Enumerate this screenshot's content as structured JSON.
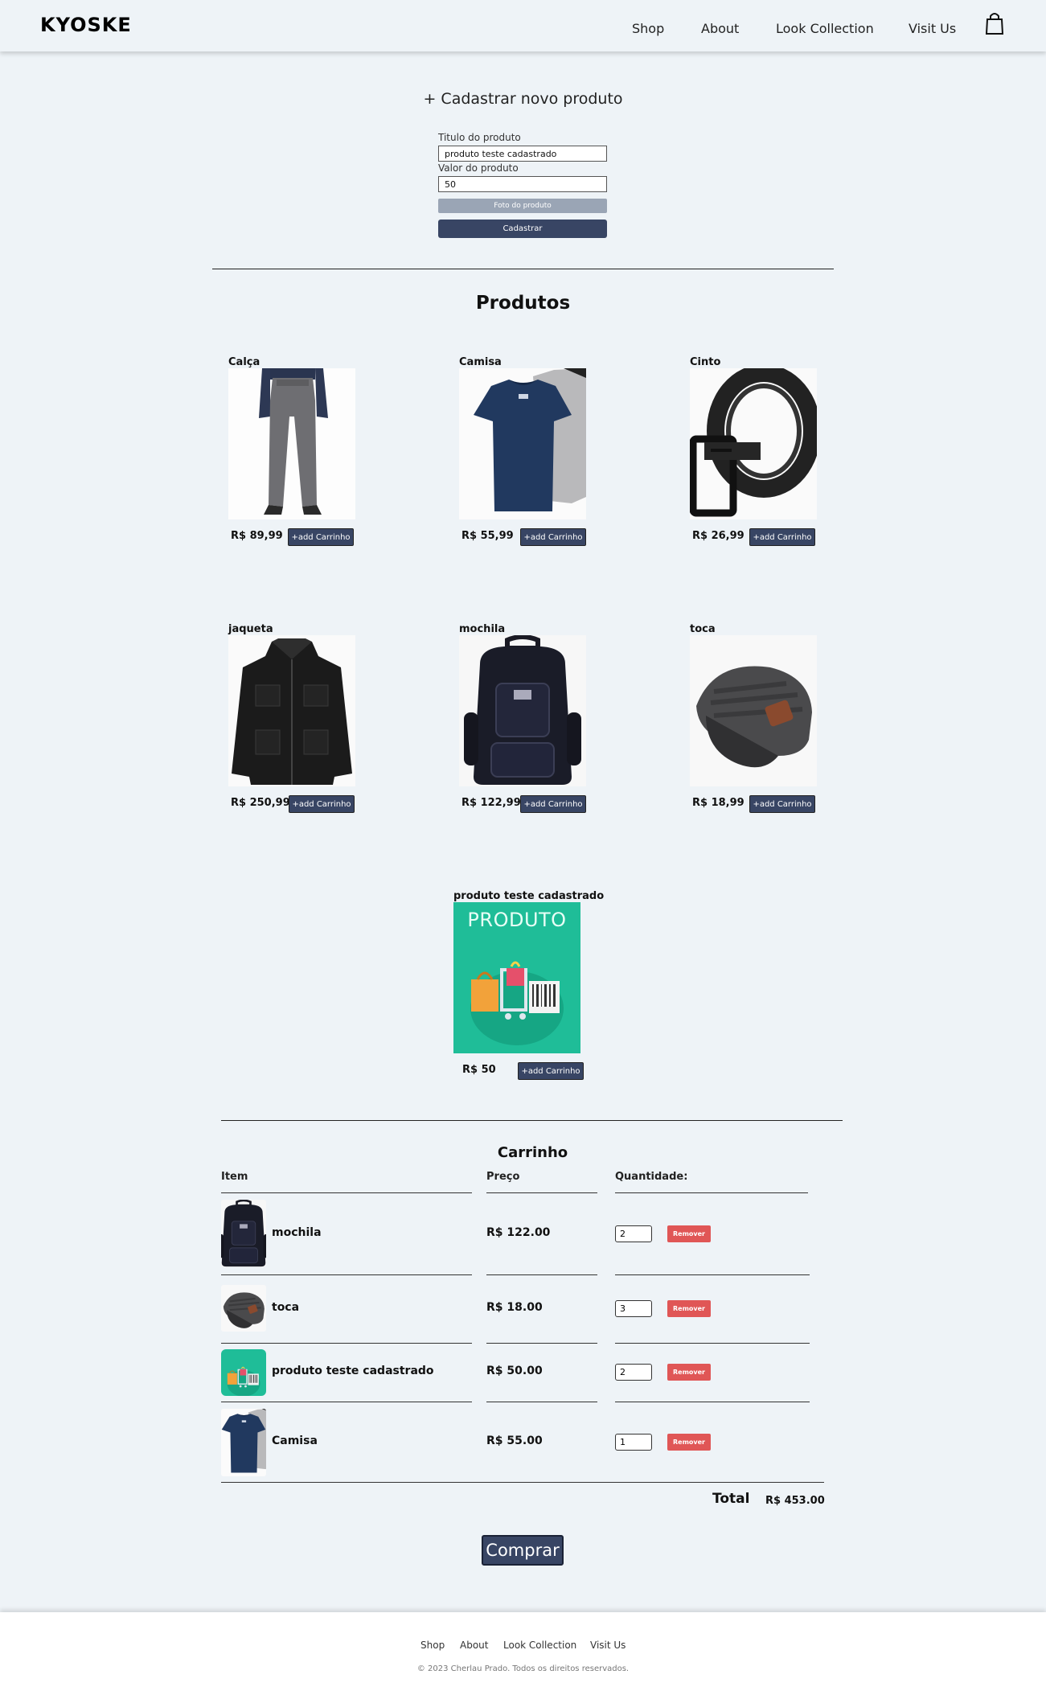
{
  "header": {
    "logo": "KYOSKE",
    "nav": [
      "Shop",
      "About",
      "Look Collection",
      "Visit Us"
    ]
  },
  "form": {
    "title": "+ Cadastrar novo produto",
    "title_label": "Titulo do produto",
    "title_value": "produto teste cadastrado",
    "value_label": "Valor do produto",
    "value_value": "50",
    "photo_button": "Foto do produto",
    "submit_button": "Cadastrar"
  },
  "products": {
    "title": "Produtos",
    "add_label": "+add Carrinho",
    "items": [
      {
        "name": "Calça",
        "price": "R$ 89,99",
        "icon": "pants-icon"
      },
      {
        "name": "Camisa",
        "price": "R$ 55,99",
        "icon": "tshirt-icon"
      },
      {
        "name": "Cinto",
        "price": "R$ 26,99",
        "icon": "belt-icon"
      },
      {
        "name": "jaqueta",
        "price": "R$ 250,99",
        "icon": "jacket-icon"
      },
      {
        "name": "mochila",
        "price": "R$ 122,99",
        "icon": "backpack-icon"
      },
      {
        "name": "toca",
        "price": "R$ 18,99",
        "icon": "beanie-icon"
      },
      {
        "name": "produto teste cadastrado",
        "price": "R$ 50",
        "icon": "produto-placeholder-icon",
        "image_text": "PRODUTO"
      }
    ]
  },
  "cart": {
    "title": "Carrinho",
    "headers": {
      "item": "Item",
      "price": "Preço",
      "qty": "Quantidade:"
    },
    "remove_label": "Remover",
    "rows": [
      {
        "name": "mochila",
        "price": "R$ 122.00",
        "qty": "2"
      },
      {
        "name": "toca",
        "price": "R$ 18.00",
        "qty": "3"
      },
      {
        "name": "produto teste cadastrado",
        "price": "R$ 50.00",
        "qty": "2"
      },
      {
        "name": "Camisa",
        "price": "R$ 55.00",
        "qty": "1"
      }
    ],
    "total_label": "Total",
    "total_value": "R$ 453.00",
    "buy_button": "Comprar"
  },
  "footer": {
    "links": [
      "Shop",
      "About",
      "Look Collection",
      "Visit Us"
    ],
    "copyright": "© 2023 Cherlau Prado. Todos os direitos reservados."
  },
  "colors": {
    "background": "#eef3f7",
    "primary_button": "#384564",
    "remove_button": "#e05656",
    "placeholder_green": "#1fbd98"
  }
}
